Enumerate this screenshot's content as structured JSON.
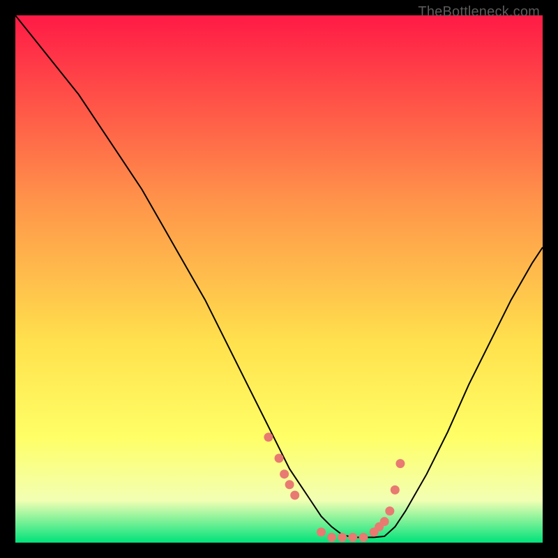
{
  "attribution": "TheBottleneck.com",
  "colors": {
    "gradient_top": "#ff1a46",
    "gradient_mid1": "#ff934a",
    "gradient_mid2": "#ffe14d",
    "gradient_mid3": "#ffff66",
    "gradient_mid4": "#f2ffb3",
    "gradient_bottom": "#00e27a",
    "curve": "#000000",
    "marker": "#e87a72"
  },
  "chart_data": {
    "type": "line",
    "title": "",
    "xlabel": "",
    "ylabel": "",
    "xlim": [
      0,
      100
    ],
    "ylim": [
      0,
      100
    ],
    "series": [
      {
        "name": "curve",
        "x": [
          0,
          4,
          8,
          12,
          16,
          20,
          24,
          28,
          32,
          36,
          40,
          44,
          48,
          52,
          56,
          58,
          60,
          62,
          64,
          66,
          68,
          70,
          72,
          74,
          78,
          82,
          86,
          90,
          94,
          98,
          100
        ],
        "y": [
          100,
          95,
          90,
          85,
          79,
          73,
          67,
          60,
          53,
          46,
          38,
          30,
          22,
          14,
          8,
          5,
          3,
          1.5,
          1,
          1,
          1,
          1.2,
          3,
          6,
          13,
          21,
          30,
          38,
          46,
          53,
          56
        ]
      }
    ],
    "markers": {
      "name": "dots",
      "x": [
        48,
        50,
        51,
        52,
        53,
        58,
        60,
        62,
        64,
        66,
        68,
        69,
        70,
        71,
        72,
        73
      ],
      "y": [
        20,
        16,
        13,
        11,
        9,
        2,
        1,
        1,
        1,
        1,
        2,
        3,
        4,
        6,
        10,
        15
      ]
    }
  }
}
